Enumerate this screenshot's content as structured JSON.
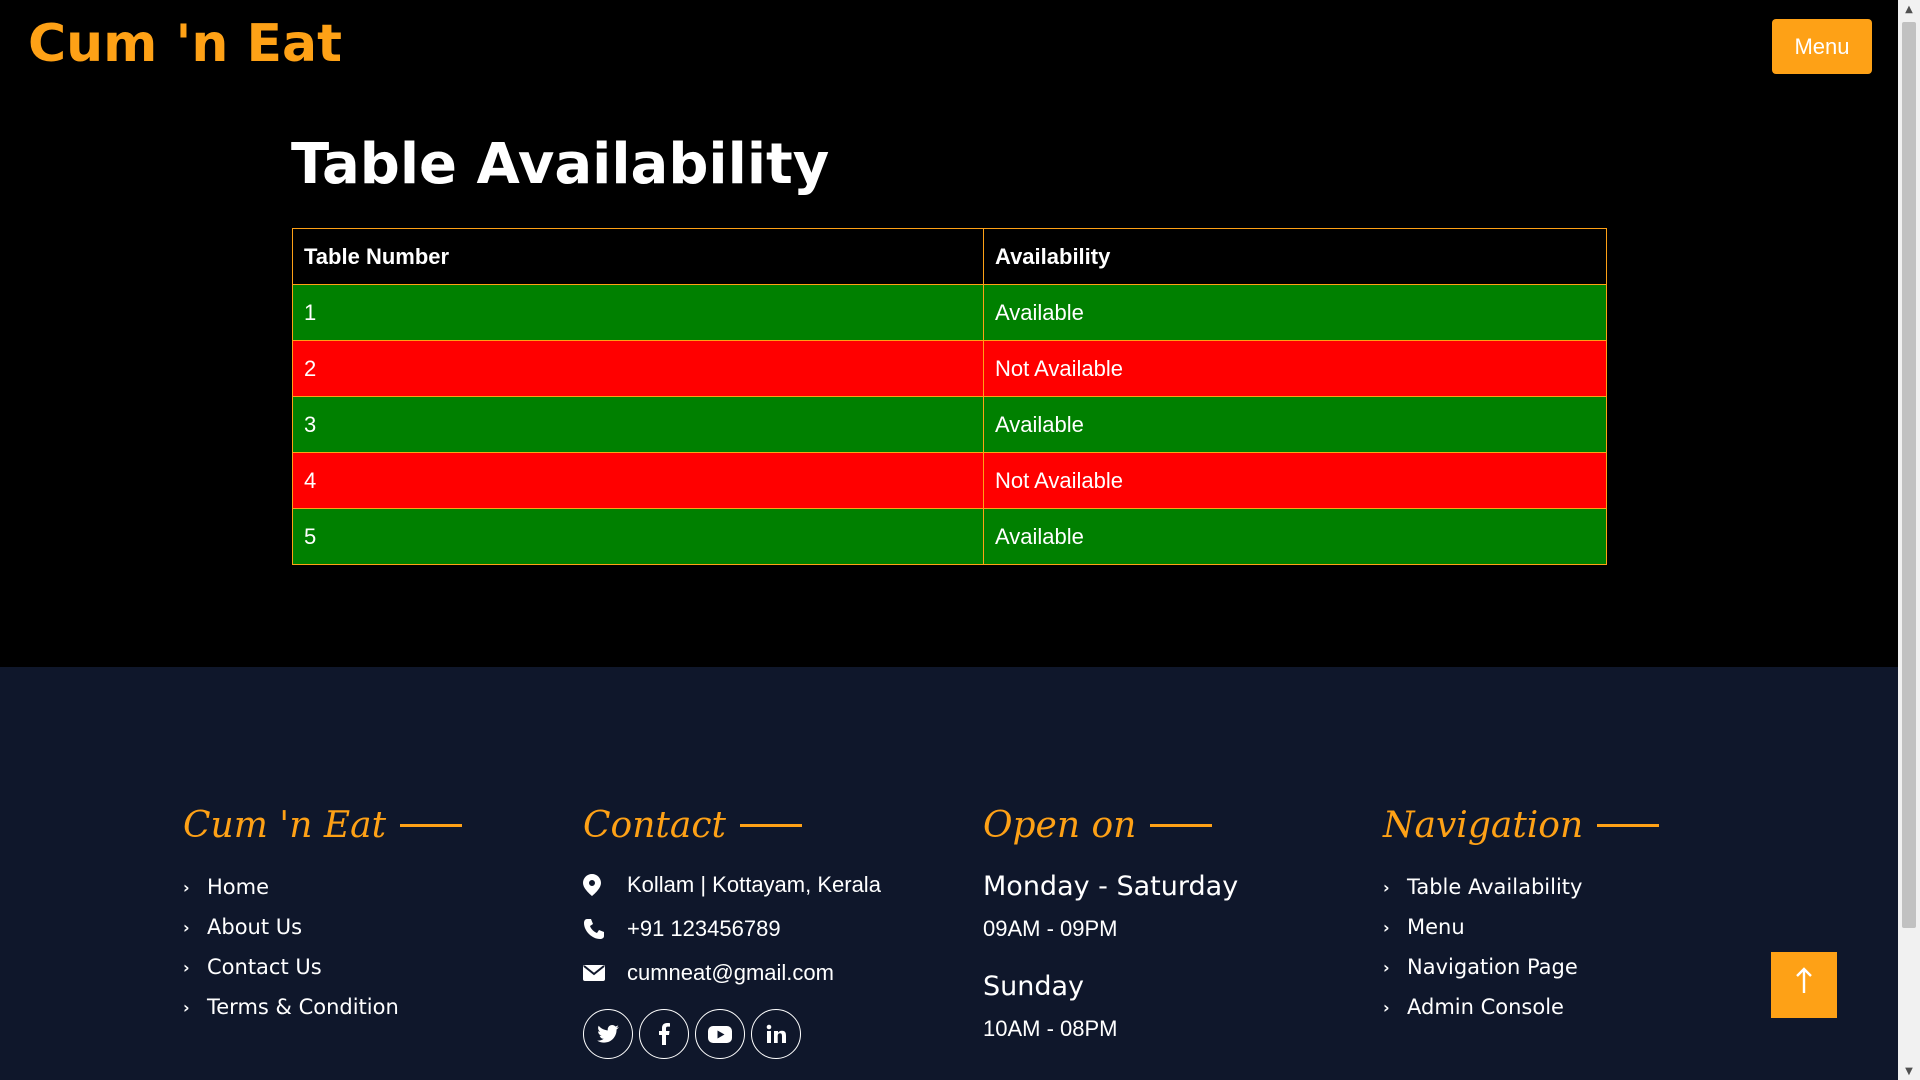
{
  "header": {
    "brand": "Cum 'n Eat",
    "menu_label": "Menu"
  },
  "main": {
    "title": "Table Availability",
    "table": {
      "headers": [
        "Table Number",
        "Availability"
      ],
      "rows": [
        {
          "number": "1",
          "status": "Available",
          "color": "#008000"
        },
        {
          "number": "2",
          "status": "Not Available",
          "color": "#FF0000"
        },
        {
          "number": "3",
          "status": "Available",
          "color": "#008000"
        },
        {
          "number": "4",
          "status": "Not Available",
          "color": "#FF0000"
        },
        {
          "number": "5",
          "status": "Available",
          "color": "#008000"
        }
      ]
    }
  },
  "footer": {
    "brand_col": {
      "title": "Cum 'n Eat",
      "links": [
        "Home",
        "About Us",
        "Contact Us",
        "Terms & Condition"
      ]
    },
    "contact_col": {
      "title": "Contact",
      "address": "Kollam | Kottayam, Kerala",
      "phone": "+91 123456789",
      "email": "cumneat@gmail.com",
      "socials": [
        "twitter-icon",
        "facebook-icon",
        "youtube-icon",
        "linkedin-icon"
      ]
    },
    "open_col": {
      "title": "Open on",
      "day1": "Monday - Saturday",
      "time1": "09AM - 09PM",
      "day2": "Sunday",
      "time2": "10AM - 08PM"
    },
    "nav_col": {
      "title": "Navigation",
      "links": [
        "Table Availability",
        "Menu",
        "Navigation Page",
        "Admin Console"
      ]
    }
  },
  "colors": {
    "accent": "#FEA116",
    "footer_bg": "#0F172B",
    "available": "#008000",
    "not_available": "#FF0000"
  }
}
